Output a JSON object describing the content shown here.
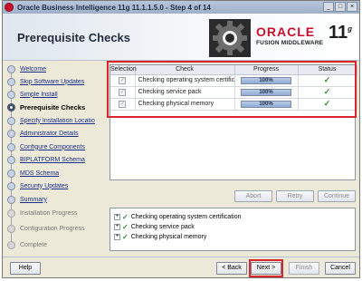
{
  "window": {
    "title": "Oracle Business Intelligence 11g 11.1.1.5.0 - Step 4 of 14",
    "buttons": [
      "_",
      "□",
      "×"
    ]
  },
  "header": {
    "page_title": "Prerequisite Checks",
    "brand": "ORACLE",
    "brand_sub": "FUSION MIDDLEWARE",
    "version": "11",
    "version_suffix": "g"
  },
  "nav": {
    "items": [
      {
        "label": "Welcome",
        "state": "done"
      },
      {
        "label": "Skip Software Updates",
        "state": "done"
      },
      {
        "label": "Simple Install",
        "state": "done"
      },
      {
        "label": "Prerequisite Checks",
        "state": "current"
      },
      {
        "label": "Specify Installation Locatio",
        "state": "done"
      },
      {
        "label": "Administrator Details",
        "state": "done"
      },
      {
        "label": "Configure Components",
        "state": "done"
      },
      {
        "label": "BIPLATFORM Schema",
        "state": "done"
      },
      {
        "label": "MDS Schema",
        "state": "done"
      },
      {
        "label": "Security Updates",
        "state": "done"
      },
      {
        "label": "Summary",
        "state": "done"
      },
      {
        "label": "Installation Progress",
        "state": "pending"
      },
      {
        "label": "Configuration Progress",
        "state": "pending"
      },
      {
        "label": "Complete",
        "state": "pending"
      }
    ]
  },
  "checks_table": {
    "headers": [
      "Selection",
      "Check",
      "Progress",
      "Status"
    ],
    "rows": [
      {
        "check": "Checking operating system certification",
        "progress": "100%",
        "progress_value": 100,
        "status": "✓"
      },
      {
        "check": "Checking service pack",
        "progress": "100%",
        "progress_value": 100,
        "status": "✓"
      },
      {
        "check": "Checking physical memory",
        "progress": "100%",
        "progress_value": 100,
        "status": "✓"
      }
    ]
  },
  "action_buttons": {
    "abort": "Abort",
    "retry": "Retry",
    "continue": "Continue"
  },
  "details": {
    "items": [
      "Checking operating system certification",
      "Checking service pack",
      "Checking physical memory"
    ]
  },
  "footer": {
    "help": "Help",
    "back": "< Back",
    "next": "Next >",
    "finish": "Finish",
    "cancel": "Cancel"
  }
}
